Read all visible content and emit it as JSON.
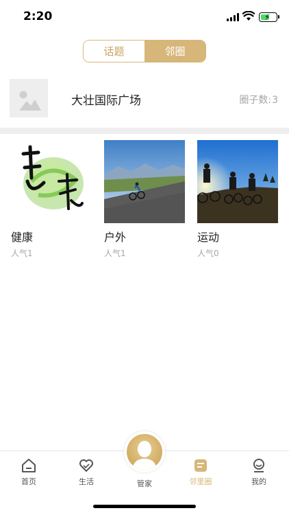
{
  "status": {
    "time": "2:20"
  },
  "tabs_top": {
    "topics": "话题",
    "neighbor_circle": "邻圈"
  },
  "community": {
    "name": "大壮国际广场",
    "member_label": "圈子数:",
    "member_count": "3"
  },
  "circles": [
    {
      "title": "健康",
      "popularity_label": "人气",
      "popularity": "1",
      "image": "calligraphy-health-icon"
    },
    {
      "title": "户外",
      "popularity_label": "人气",
      "popularity": "1",
      "image": "cyclist-mountain-road-photo"
    },
    {
      "title": "运动",
      "popularity_label": "人气",
      "popularity": "0",
      "image": "cyclists-sunset-photo"
    }
  ],
  "tab_bar": {
    "home": "首页",
    "life": "生活",
    "butler": "管家",
    "neighborhood": "邻里圈",
    "mine": "我的"
  },
  "colors": {
    "accent": "#d6b779",
    "muted": "#a6a6a6"
  }
}
